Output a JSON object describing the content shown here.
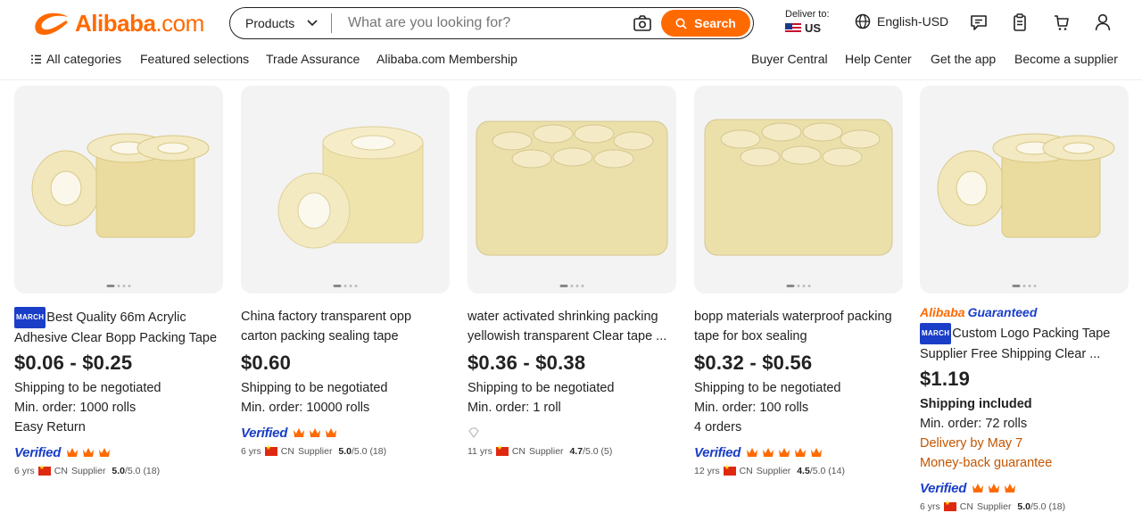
{
  "header": {
    "logo_text": "Alibaba",
    "logo_suffix": ".com",
    "search_category": "Products",
    "search_placeholder": "What are you looking for?",
    "search_button": "Search",
    "deliver_label": "Deliver to:",
    "deliver_country": "US",
    "language": "English-USD",
    "brand_color": "#ff6a00"
  },
  "nav": {
    "all_categories": "All categories",
    "featured": "Featured selections",
    "trade_assurance": "Trade Assurance",
    "membership": "Alibaba.com Membership",
    "buyer_central": "Buyer Central",
    "help_center": "Help Center",
    "get_app": "Get the app",
    "become_supplier": "Become a supplier"
  },
  "products": [
    {
      "badge": "MARCH",
      "title": "Best Quality 66m Acrylic Adhesive Clear Bopp Packing Tape",
      "price": "$0.06 - $0.25",
      "shipping": "Shipping to be negotiated",
      "moq": "Min. order: 1000 rolls",
      "extra": "Easy Return",
      "verified": "Verified",
      "years": "6 yrs",
      "country": "CN",
      "supplier": "Supplier",
      "rating": "5.0",
      "rating_max": "/5.0",
      "reviews": "(18)"
    },
    {
      "badge": "",
      "title": "China factory transparent opp carton packing sealing tape",
      "price": "$0.60",
      "shipping": "Shipping to be negotiated",
      "moq": "Min. order: 10000 rolls",
      "verified": "Verified",
      "years": "6 yrs",
      "country": "CN",
      "supplier": "Supplier",
      "rating": "5.0",
      "rating_max": "/5.0",
      "reviews": "(18)"
    },
    {
      "badge": "",
      "title": "water activated shrinking packing yellowish transparent Clear tape ...",
      "price": "$0.36 - $0.38",
      "shipping": "Shipping to be negotiated",
      "moq": "Min. order: 1 roll",
      "years": "11 yrs",
      "country": "CN",
      "supplier": "Supplier",
      "rating": "4.7",
      "rating_max": "/5.0",
      "reviews": "(5)"
    },
    {
      "badge": "",
      "title": "bopp materials waterproof packing tape for box sealing",
      "price": "$0.32 - $0.56",
      "shipping": "Shipping to be negotiated",
      "moq": "Min. order: 100 rolls",
      "extra": "4 orders",
      "verified": "Verified",
      "years": "12 yrs",
      "country": "CN",
      "supplier": "Supplier",
      "rating": "4.5",
      "rating_max": "/5.0",
      "reviews": "(14)"
    },
    {
      "guaranteed_a": "Alibaba",
      "guaranteed_b": "Guaranteed",
      "badge": "MARCH",
      "title": "Custom Logo Packing Tape Supplier Free Shipping Clear ...",
      "price": "$1.19",
      "shipping": "Shipping included",
      "moq": "Min. order: 72 rolls",
      "delivery": "Delivery by May 7",
      "guarantee": "Money-back guarantee",
      "verified": "Verified",
      "years": "6 yrs",
      "country": "CN",
      "supplier": "Supplier",
      "rating": "5.0",
      "rating_max": "/5.0",
      "reviews": "(18)"
    }
  ]
}
